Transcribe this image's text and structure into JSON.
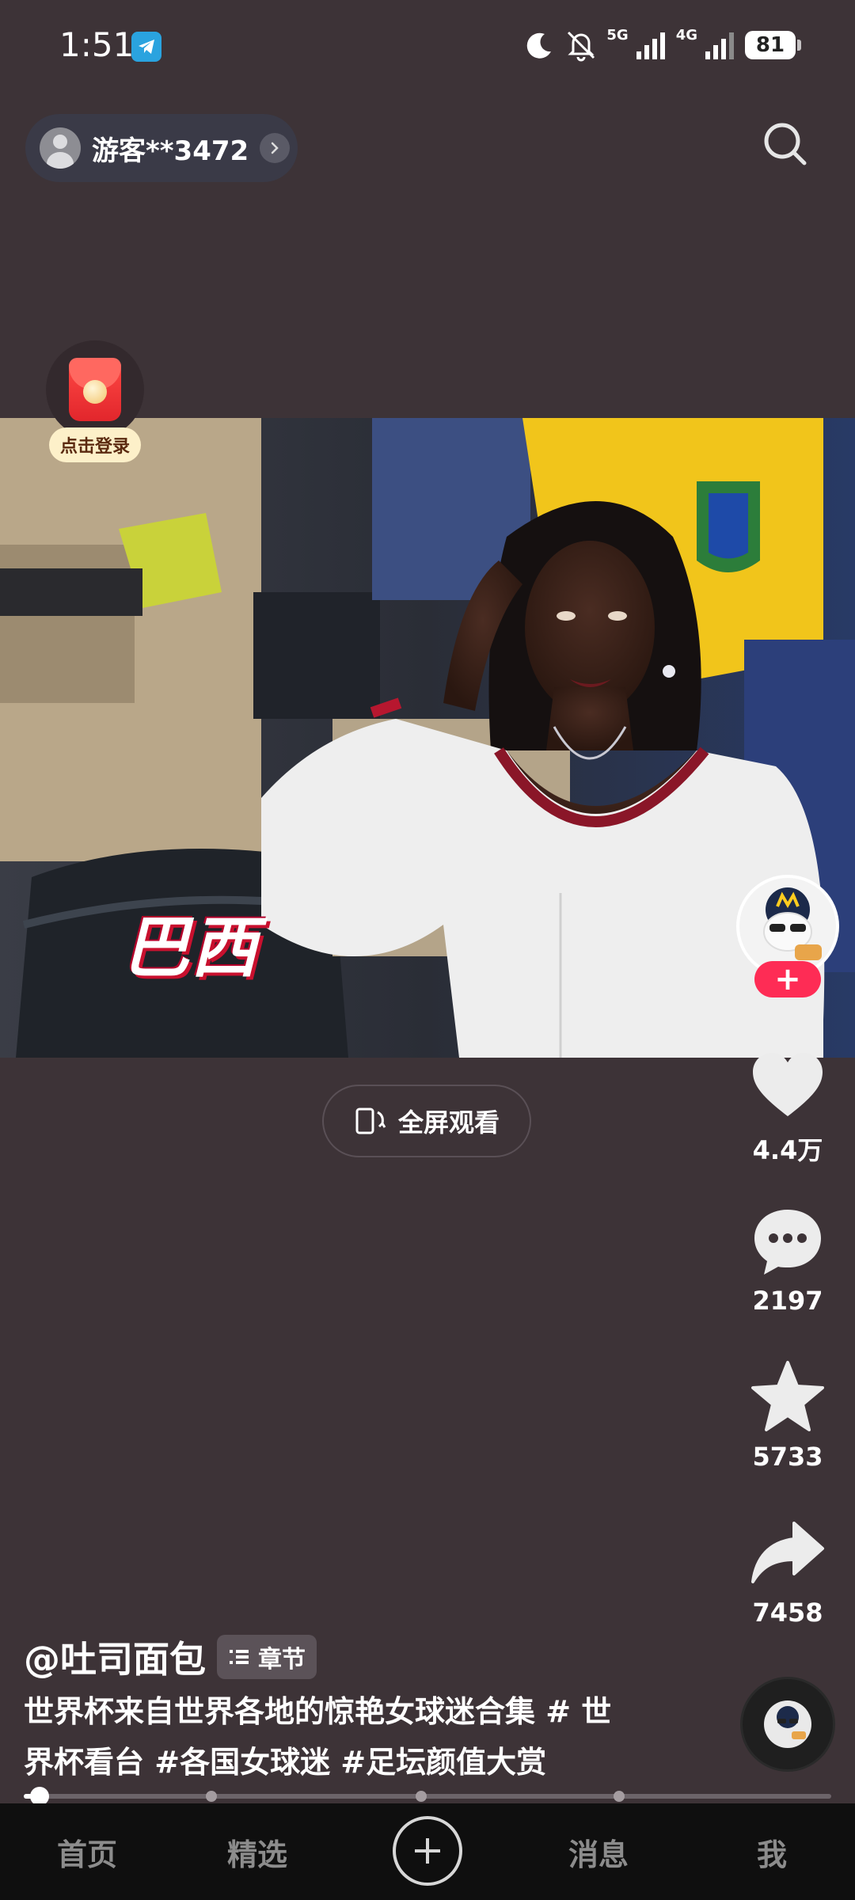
{
  "status_bar": {
    "time": "1:51",
    "network_5g": "5G",
    "network_4g": "4G",
    "battery": "81"
  },
  "header": {
    "guest_name": "游客**3472"
  },
  "red_packet": {
    "label": "点击登录"
  },
  "video": {
    "caption": "巴西"
  },
  "fullscreen": {
    "label": "全屏观看"
  },
  "actions": {
    "like_count": "4.4万",
    "comment_count": "2197",
    "favorite_count": "5733",
    "share_count": "7458"
  },
  "post": {
    "author": "@吐司面包",
    "chapter_label": "章节",
    "description": "世界杯来自世界各地的惊艳女球迷合集 # 世界杯看台 #各国女球迷 #足坛颜值大赏"
  },
  "progress": {
    "played_fraction": 0.02
  },
  "bottom_nav": {
    "home": "首页",
    "featured": "精选",
    "messages": "消息",
    "me": "我"
  },
  "colors": {
    "background": "#3d3337",
    "accent": "#fe2c55",
    "nav_bg": "#0f0f0f"
  }
}
